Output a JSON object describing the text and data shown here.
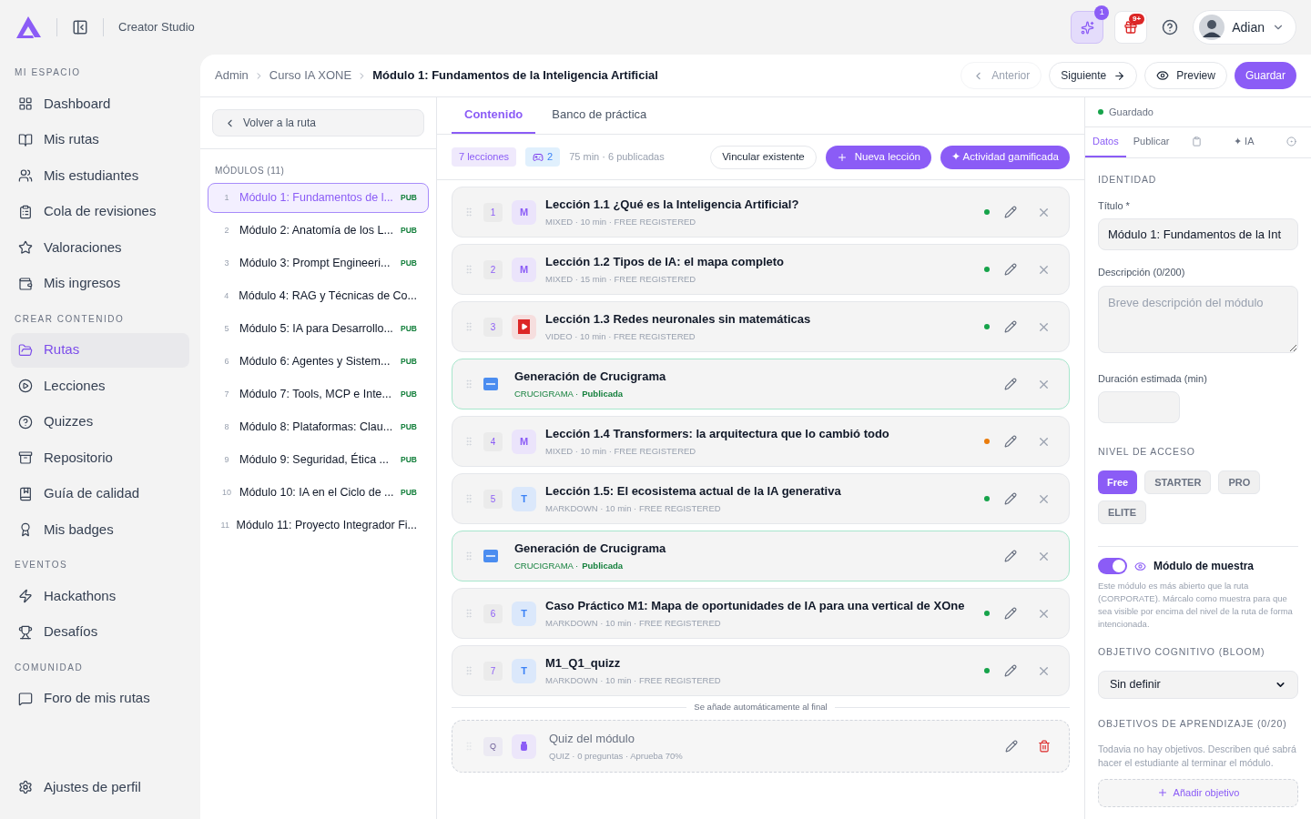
{
  "topbar": {
    "app_name": "Creator Studio",
    "ai_badge": "1",
    "notifications_badge": "9+",
    "user": "Adian"
  },
  "sidebar": {
    "sections": [
      {
        "title": "MI ESPACIO",
        "items": [
          {
            "label": "Dashboard",
            "selected": false
          },
          {
            "label": "Mis rutas",
            "selected": false
          },
          {
            "label": "Mis estudiantes",
            "selected": false
          },
          {
            "label": "Cola de revisiones",
            "selected": false
          },
          {
            "label": "Valoraciones",
            "selected": false
          },
          {
            "label": "Mis ingresos",
            "selected": false
          }
        ]
      },
      {
        "title": "CREAR CONTENIDO",
        "items": [
          {
            "label": "Rutas",
            "selected": true
          },
          {
            "label": "Lecciones",
            "selected": false
          },
          {
            "label": "Quizzes",
            "selected": false
          },
          {
            "label": "Repositorio",
            "selected": false
          },
          {
            "label": "Guía de calidad",
            "selected": false
          },
          {
            "label": "Mis badges",
            "selected": false
          }
        ]
      },
      {
        "title": "EVENTOS",
        "items": [
          {
            "label": "Hackathons",
            "selected": false
          },
          {
            "label": "Desafíos",
            "selected": false
          }
        ]
      },
      {
        "title": "COMUNIDAD",
        "items": [
          {
            "label": "Foro de mis rutas",
            "selected": false
          }
        ]
      }
    ],
    "footer": "Ajustes de perfil"
  },
  "breadcrumb": [
    "Admin",
    "Curso IA XONE",
    "Módulo 1: Fundamentos de la Inteligencia Artificial"
  ],
  "header_actions": {
    "previous": {
      "label": "Anterior",
      "disabled": true
    },
    "next": "Siguiente",
    "preview": "Preview",
    "save": "Guardar"
  },
  "modules": {
    "back": "Volver a la ruta",
    "title": "MÓDULOS (11)",
    "items": [
      {
        "number": "1",
        "title": "Módulo 1: Fundamentos de l...",
        "badge": "PUB",
        "selected": true
      },
      {
        "number": "2",
        "title": "Módulo 2: Anatomía de los L...",
        "badge": "PUB",
        "selected": false
      },
      {
        "number": "3",
        "title": "Módulo 3: Prompt Engineeri...",
        "badge": "PUB",
        "selected": false
      },
      {
        "number": "4",
        "title": "Módulo 4: RAG y Técnicas de Co...",
        "selected": false
      },
      {
        "number": "5",
        "title": "Módulo 5: IA para Desarrollo...",
        "badge": "PUB",
        "selected": false
      },
      {
        "number": "6",
        "title": "Módulo 6: Agentes y Sistem...",
        "badge": "PUB",
        "selected": false
      },
      {
        "number": "7",
        "title": "Módulo 7: Tools, MCP e Inte...",
        "badge": "PUB",
        "selected": false
      },
      {
        "number": "8",
        "title": "Módulo 8: Plataformas: Clau...",
        "badge": "PUB",
        "selected": false
      },
      {
        "number": "9",
        "title": "Módulo 9: Seguridad, Ética ...",
        "badge": "PUB",
        "selected": false
      },
      {
        "number": "10",
        "title": "Módulo 10: IA en el Ciclo de ...",
        "badge": "PUB",
        "selected": false
      },
      {
        "number": "11",
        "title": "Módulo 11: Proyecto Integrador Fi...",
        "selected": false
      }
    ]
  },
  "content": {
    "tabs": [
      {
        "label": "Contenido",
        "selected": true
      },
      {
        "label": "Banco de práctica",
        "selected": false
      }
    ],
    "stats": {
      "lessons": "7 lecciones",
      "games": "2",
      "summary": "75 min · 6 publicadas"
    },
    "actions": {
      "link": "Vincular existente",
      "new_lesson": "Nueva lección",
      "gamified": "✦ Actividad gamificada"
    },
    "items": [
      {
        "kind": "mixed",
        "number": "1",
        "badge": "M",
        "title": "Lección 1.1 ¿Qué es la Inteligencia Artificial?",
        "meta": "MIXED · 10 min · FREE REGISTERED",
        "color": "#16a34a"
      },
      {
        "kind": "mixed",
        "number": "2",
        "badge": "M",
        "title": "Lección 1.2 Tipos de IA: el mapa completo",
        "meta": "MIXED · 15 min · FREE REGISTERED",
        "color": "#16a34a"
      },
      {
        "kind": "video",
        "number": "3",
        "title": "Lección 1.3 Redes neuronales sin matemáticas",
        "meta": "VIDEO · 10 min · FREE REGISTERED",
        "color": "#16a34a"
      },
      {
        "kind": "activity",
        "title": "Generación de Crucigrama",
        "meta": "CRUCIGRAMA ·",
        "status": "Publicada"
      },
      {
        "kind": "mixed",
        "number": "4",
        "badge": "M",
        "title": "Lección 1.4 Transformers: la arquitectura que lo cambió todo",
        "meta": "MIXED · 10 min · FREE REGISTERED",
        "color": "#ea7c0c"
      },
      {
        "kind": "markdown",
        "number": "5",
        "badge": "T",
        "title": "Lección 1.5: El ecosistema actual de la IA generativa",
        "meta": "MARKDOWN · 10 min · FREE REGISTERED",
        "color": "#16a34a"
      },
      {
        "kind": "activity",
        "title": "Generación de Crucigrama",
        "meta": "CRUCIGRAMA ·",
        "status": "Publicada"
      },
      {
        "kind": "markdown",
        "number": "6",
        "badge": "T",
        "title": "Caso Práctico M1: Mapa de oportunidades de IA para una vertical de XOne",
        "meta": "MARKDOWN · 10 min · FREE REGISTERED",
        "color": "#16a34a"
      },
      {
        "kind": "markdown",
        "number": "7",
        "badge": "T",
        "title": "M1_Q1_quizz",
        "meta": "MARKDOWN · 10 min · FREE REGISTERED",
        "color": "#16a34a"
      }
    ],
    "divider": "Se añade automáticamente al final",
    "quiz": {
      "badge": "Q",
      "title": "Quiz del módulo",
      "meta": "QUIZ · 0 preguntas · Aprueba 70%"
    }
  },
  "panel": {
    "status": "Guardado",
    "tabs": [
      {
        "kind": "text",
        "label": "Datos",
        "selected": true
      },
      {
        "kind": "text",
        "label": "Publicar",
        "selected": false
      },
      {
        "kind": "icon",
        "selected": false
      },
      {
        "kind": "text",
        "label": "✦ IA",
        "selected": false
      },
      {
        "kind": "icon",
        "selected": false
      }
    ],
    "identity": "IDENTIDAD",
    "title_label": "Título *",
    "title_value": "Módulo 1: Fundamentos de la Int",
    "description_label": "Descripción (0/200)",
    "description_placeholder": "Breve descripción del módulo",
    "duration_label": "Duración estimada (min)",
    "access_title": "NIVEL DE ACCESO",
    "access_levels": [
      {
        "label": "Free",
        "selected": true
      },
      {
        "label": "STARTER",
        "selected": false
      },
      {
        "label": "PRO",
        "selected": false
      },
      {
        "label": "ELITE",
        "selected": false
      }
    ],
    "sample": {
      "on": true,
      "label": "Módulo de muestra",
      "help": "Este módulo es más abierto que la ruta (CORPORATE). Márcalo como muestra para que sea visible por encima del nivel de la ruta de forma intencionada."
    },
    "bloom_title": "OBJETIVO COGNITIVO (BLOOM)",
    "bloom_value": "Sin definir",
    "objectives_title": "OBJETIVOS DE APRENDIZAJE (0/20)",
    "objectives_empty": "Todavia no hay objetivos. Describen qué sabrá hacer el estudiante al terminar el módulo.",
    "add_objective": "Añadir objetivo"
  }
}
